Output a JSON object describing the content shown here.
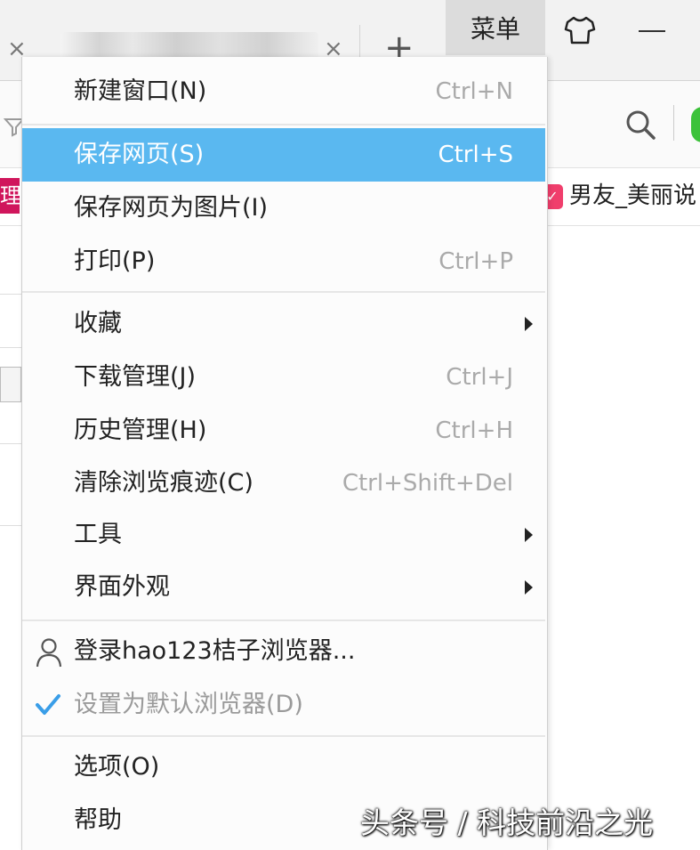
{
  "tabbar": {
    "close_glyph": "×",
    "new_tab_glyph": "+",
    "menu_button": "菜单"
  },
  "favorites": {
    "left_fragment": "理",
    "right_label": "男友_美丽说"
  },
  "menu": {
    "items": [
      {
        "label": "新建窗口(N)",
        "shortcut": "Ctrl+N"
      },
      {
        "label": "保存网页(S)",
        "shortcut": "Ctrl+S"
      },
      {
        "label": "保存网页为图片(I)",
        "shortcut": ""
      },
      {
        "label": "打印(P)",
        "shortcut": "Ctrl+P"
      },
      {
        "label": "收藏",
        "shortcut": ""
      },
      {
        "label": "下载管理(J)",
        "shortcut": "Ctrl+J"
      },
      {
        "label": "历史管理(H)",
        "shortcut": "Ctrl+H"
      },
      {
        "label": "清除浏览痕迹(C)",
        "shortcut": "Ctrl+Shift+Del"
      },
      {
        "label": "工具",
        "shortcut": ""
      },
      {
        "label": "界面外观",
        "shortcut": ""
      },
      {
        "label": "登录hao123桔子浏览器...",
        "shortcut": ""
      },
      {
        "label": "设置为默认浏览器(D)",
        "shortcut": ""
      },
      {
        "label": "选项(O)",
        "shortcut": ""
      },
      {
        "label": "帮助",
        "shortcut": ""
      }
    ],
    "highlighted_item": "保存网页(S)",
    "highlight_color": "#5ab8f0"
  },
  "watermark": "头条号 / 科技前沿之光",
  "colors": {
    "checkmark": "#3a9ee8",
    "menu_button_bg": "#dcdcdc"
  }
}
